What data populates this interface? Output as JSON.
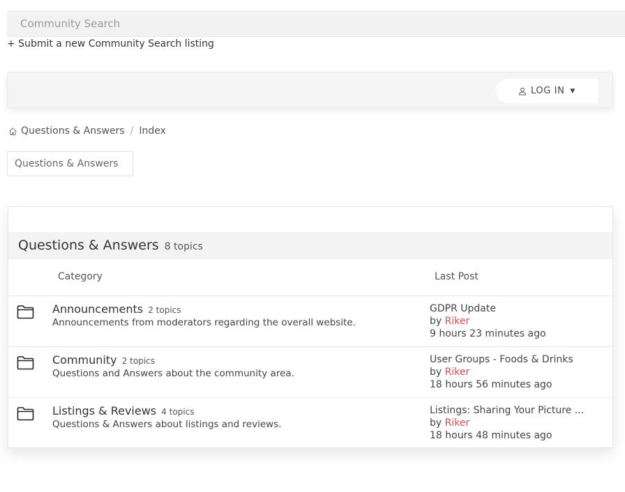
{
  "search": {
    "label": "Community Search"
  },
  "submit_link": "+ Submit a new Community Search listing",
  "toolbar": {
    "login_label": "LOG IN",
    "user_icon": "user-icon",
    "caret_icon": "caret-down-icon"
  },
  "breadcrumb": {
    "home_icon": "home-icon",
    "items": [
      "Questions & Answers",
      "Index"
    ],
    "separator": "/"
  },
  "tab": {
    "label": "Questions & Answers"
  },
  "forum": {
    "title": "Questions & Answers",
    "topic_count": "8 topics",
    "columns": {
      "category": "Category",
      "last_post": "Last Post"
    },
    "categories": [
      {
        "name": "Announcements",
        "count": "2 topics",
        "description": "Announcements from moderators regarding the overall website.",
        "last_post_title": "GDPR Update",
        "by": "by",
        "author": "Riker",
        "time": "9 hours 23 minutes ago"
      },
      {
        "name": "Community",
        "count": "2 topics",
        "description": "Questions and Answers about the community area.",
        "last_post_title": "User Groups - Foods & Drinks",
        "by": "by",
        "author": "Riker",
        "time": "18 hours 56 minutes ago"
      },
      {
        "name": "Listings & Reviews",
        "count": "4 topics",
        "description": "Questions & Answers about listings and reviews.",
        "last_post_title": "Listings: Sharing Your Picture ...",
        "by": "by",
        "author": "Riker",
        "time": "18 hours 48 minutes ago"
      }
    ]
  },
  "colors": {
    "author": "#e0484e",
    "panel_header_bg": "#f3f3f3",
    "search_bg": "#f2f2f2"
  }
}
